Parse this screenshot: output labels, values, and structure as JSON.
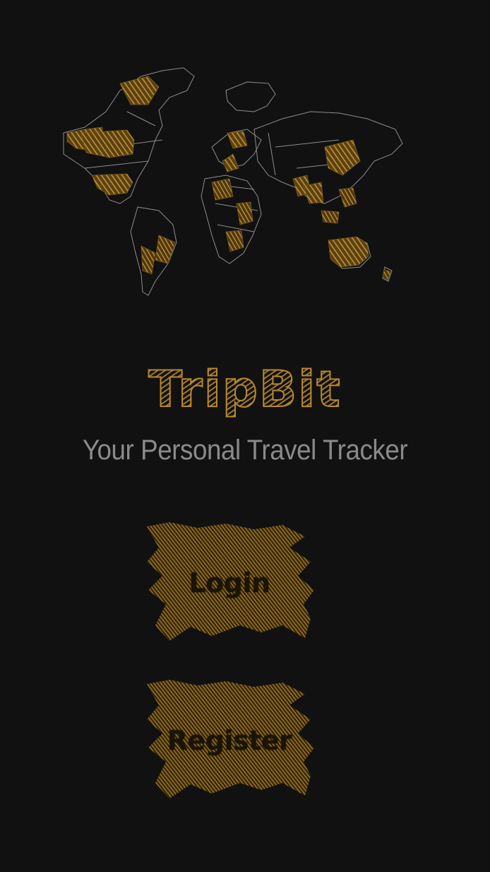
{
  "app": {
    "title": "TripBit",
    "tagline": "Your Personal Travel Tracker"
  },
  "actions": {
    "login_label": "Login",
    "register_label": "Register"
  },
  "colors": {
    "background": "#111112",
    "accent_gold": "#b98a2a",
    "tagline_gray": "#8a8a8a",
    "map_outline": "#8d8d8d"
  },
  "icons": {
    "map": "world-map-icon"
  }
}
